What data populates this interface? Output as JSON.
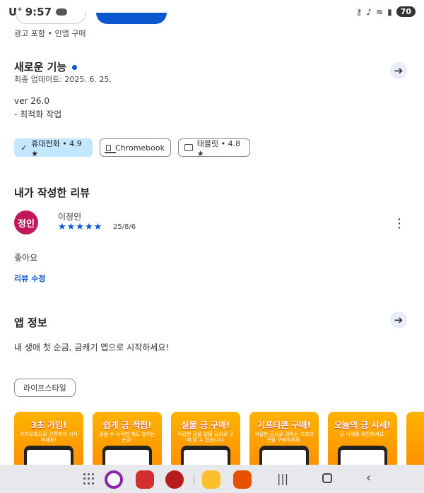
{
  "status_bar": {
    "carrier": "U",
    "carrier_sup": "+",
    "time": "9:57",
    "battery": "70"
  },
  "ads_label": "광고 포함 • 인앱 구매",
  "whats_new": {
    "title": "새로운 기능",
    "updated": "최종 업데이트: 2025. 6. 25.",
    "version": "ver 26.0",
    "note": "- 최적화 작업"
  },
  "device_chips": [
    {
      "label": "휴대전화 • 4.9 ★",
      "selected": true
    },
    {
      "label": "Chromebook",
      "selected": false
    },
    {
      "label": "태블릿 • 4.8 ★",
      "selected": false
    }
  ],
  "my_review": {
    "title": "내가 작성한 리뷰",
    "avatar_text": "정인",
    "reviewer": "이정인",
    "stars": "★★★★★",
    "date": "25/8/6",
    "text": "좋아요",
    "edit_link": "리뷰 수정"
  },
  "app_info": {
    "title": "앱 정보",
    "description": "내 생애 첫 순금, 금캐기 앱으로 시작하세요!",
    "tag": "라이프스타일"
  },
  "screenshots": [
    {
      "title": "3초 가입!",
      "sub": "카카오톡으로 간편하게 시작하세요!"
    },
    {
      "title": "쉽게 금 적립!",
      "sub": "걸음 수 누적만 해도 쌓이는 순금!"
    },
    {
      "title": "실물 금 구매!",
      "sub": "적립한 금을 실물 금으로 구매 할 수 있습니다."
    },
    {
      "title": "기프티콘 구매!",
      "sub": "적립한 금으로 원하는 기프티콘을 구매하세요."
    },
    {
      "title": "오늘의 금 시세!",
      "sub": "금 시세를 확인하세요."
    }
  ],
  "colors": {
    "accent": "#0b57d0",
    "chip_selected": "#c2e7ff",
    "avatar": "#c2185b"
  }
}
